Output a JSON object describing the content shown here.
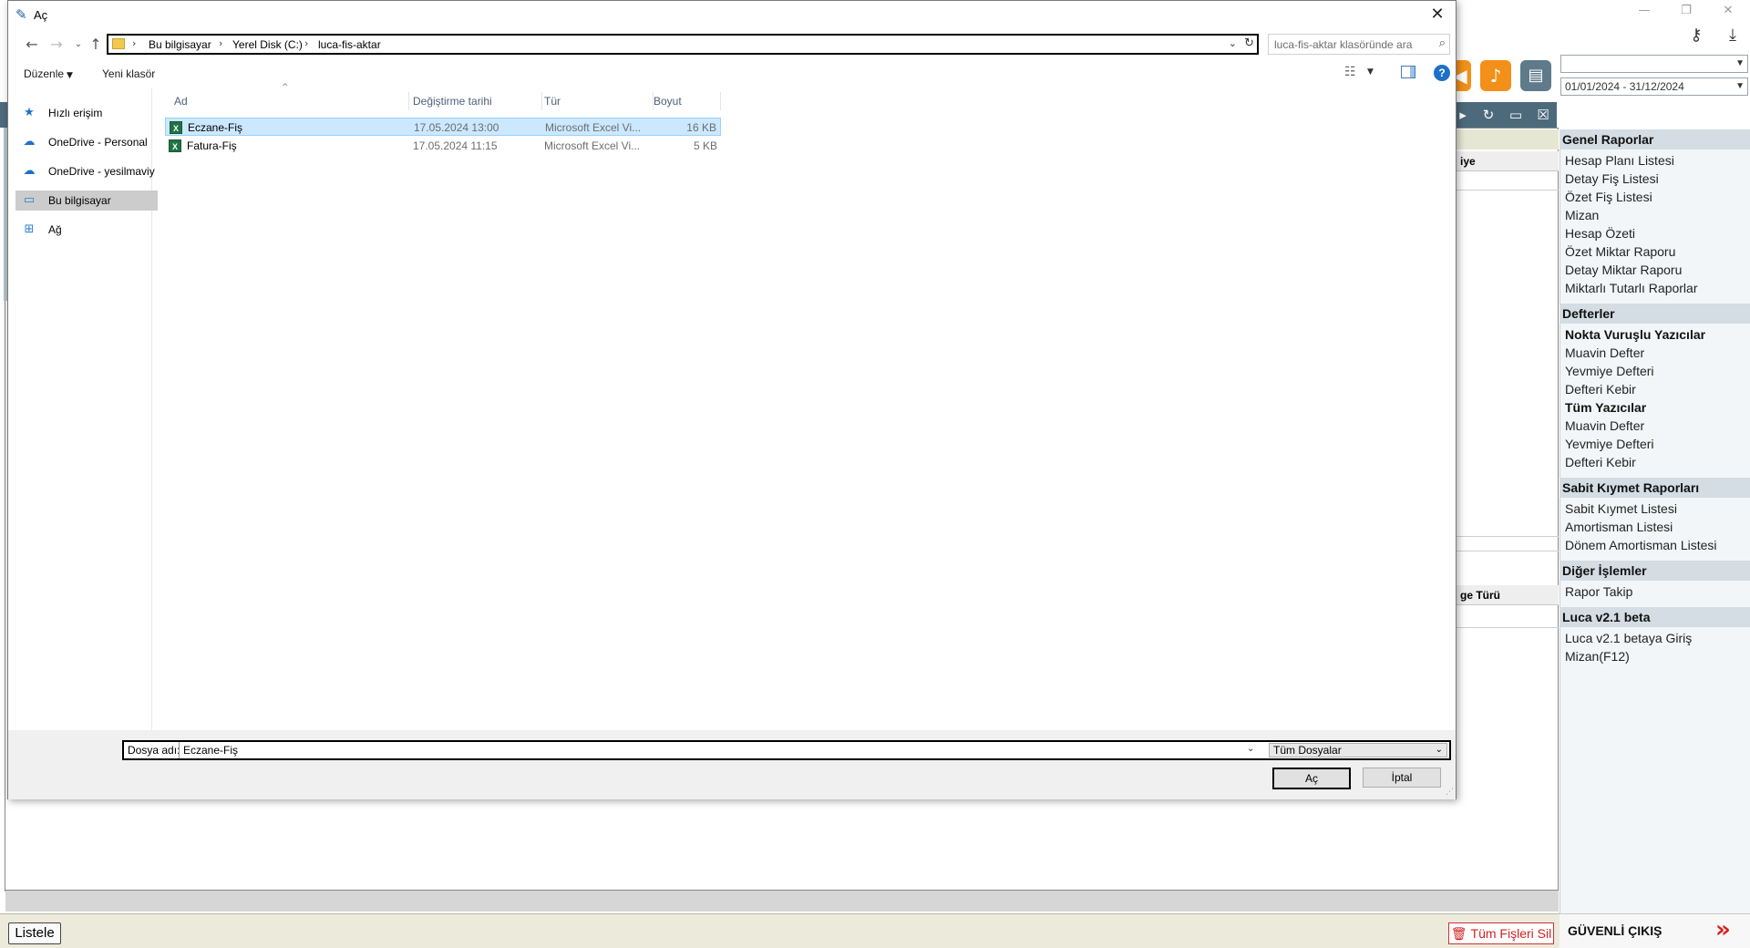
{
  "app": {
    "date_range": "01/01/2024 - 31/12/2024",
    "period_select": "",
    "grid_header_1": "iye",
    "grid_header_2": "ge Türü",
    "list_button": "Listele",
    "delete_all_button": "Tüm Fişleri Sil",
    "safe_exit": "GÜVENLİ ÇIKIŞ",
    "colors": {
      "dark_bar": "#4d6a7c",
      "accent_orange": "#f29019",
      "danger": "#d21f1f"
    }
  },
  "side_menu": {
    "sections": [
      {
        "title": "Genel Raporlar",
        "items": [
          {
            "label": "Hesap Planı Listesi",
            "strong": false
          },
          {
            "label": "Detay Fiş Listesi",
            "strong": false
          },
          {
            "label": "Özet Fiş Listesi",
            "strong": false
          },
          {
            "label": "Mizan",
            "strong": false
          },
          {
            "label": "Hesap Özeti",
            "strong": false
          },
          {
            "label": "Özet Miktar Raporu",
            "strong": false
          },
          {
            "label": "Detay Miktar Raporu",
            "strong": false
          },
          {
            "label": "Miktarlı Tutarlı Raporlar",
            "strong": false
          }
        ]
      },
      {
        "title": "Defterler",
        "items": [
          {
            "label": "Nokta Vuruşlu Yazıcılar",
            "strong": true
          },
          {
            "label": "Muavin Defter",
            "strong": false
          },
          {
            "label": "Yevmiye Defteri",
            "strong": false
          },
          {
            "label": "Defteri Kebir",
            "strong": false
          },
          {
            "label": "Tüm Yazıcılar",
            "strong": true
          },
          {
            "label": "Muavin Defter",
            "strong": false
          },
          {
            "label": "Yevmiye Defteri",
            "strong": false
          },
          {
            "label": "Defteri Kebir",
            "strong": false
          }
        ]
      },
      {
        "title": "Sabit Kıymet Raporları",
        "items": [
          {
            "label": "Sabit Kıymet Listesi",
            "strong": false
          },
          {
            "label": "Amortisman Listesi",
            "strong": false
          },
          {
            "label": "Dönem Amortisman Listesi",
            "strong": false
          }
        ]
      },
      {
        "title": "Diğer İşlemler",
        "items": [
          {
            "label": "Rapor Takip",
            "strong": false
          }
        ]
      },
      {
        "title": "Luca v2.1 beta",
        "items": [
          {
            "label": "Luca v2.1 betaya Giriş",
            "strong": false
          },
          {
            "label": "Mizan(F12)",
            "strong": false
          }
        ]
      }
    ]
  },
  "dialog": {
    "title": "Aç",
    "breadcrumb": [
      "Bu bilgisayar",
      "Yerel Disk (C:)",
      "luca-fis-aktar"
    ],
    "search_placeholder": "luca-fis-aktar klasöründe ara",
    "organize_label": "Düzenle",
    "new_folder_label": "Yeni klasör",
    "help_label": "?",
    "nav_items": [
      {
        "label": "Hızlı erişim",
        "icon": "star-icon",
        "selected": false
      },
      {
        "label": "OneDrive - Personal",
        "icon": "cloud-icon",
        "selected": false
      },
      {
        "label": "OneDrive - yesilmaviy",
        "icon": "cloud-icon",
        "selected": false
      },
      {
        "label": "Bu bilgisayar",
        "icon": "computer-icon",
        "selected": true
      },
      {
        "label": "Ağ",
        "icon": "network-icon",
        "selected": false
      }
    ],
    "columns": {
      "name": "Ad",
      "modified": "Değiştirme tarihi",
      "type": "Tür",
      "size": "Boyut"
    },
    "files": [
      {
        "name": "Eczane-Fiş",
        "modified": "17.05.2024 13:00",
        "type": "Microsoft Excel Vi...",
        "size": "16 KB",
        "selected": true
      },
      {
        "name": "Fatura-Fiş",
        "modified": "17.05.2024 11:15",
        "type": "Microsoft Excel Vi...",
        "size": "5 KB",
        "selected": false
      }
    ],
    "file_name_label": "Dosya adı:",
    "file_name_value": "Eczane-Fiş",
    "file_type_value": "Tüm Dosyalar",
    "open_button": "Aç",
    "cancel_button": "İptal"
  }
}
